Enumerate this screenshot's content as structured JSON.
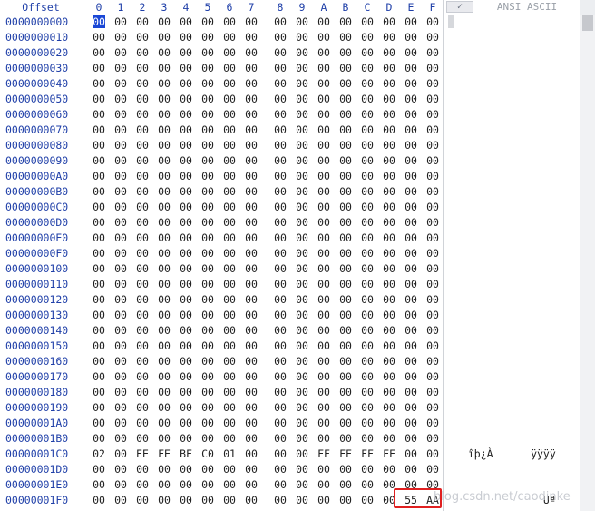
{
  "header": {
    "offset_label": "Offset",
    "columns": [
      "0",
      "1",
      "2",
      "3",
      "4",
      "5",
      "6",
      "7",
      "8",
      "9",
      "A",
      "B",
      "C",
      "D",
      "E",
      "F"
    ],
    "check_label": "✓",
    "ansi_label": "ANSI ASCII"
  },
  "rows": [
    {
      "addr": "0000000000",
      "bytes": [
        "00",
        "00",
        "00",
        "00",
        "00",
        "00",
        "00",
        "00",
        "00",
        "00",
        "00",
        "00",
        "00",
        "00",
        "00",
        "00"
      ],
      "ascii": ""
    },
    {
      "addr": "0000000010",
      "bytes": [
        "00",
        "00",
        "00",
        "00",
        "00",
        "00",
        "00",
        "00",
        "00",
        "00",
        "00",
        "00",
        "00",
        "00",
        "00",
        "00"
      ],
      "ascii": ""
    },
    {
      "addr": "0000000020",
      "bytes": [
        "00",
        "00",
        "00",
        "00",
        "00",
        "00",
        "00",
        "00",
        "00",
        "00",
        "00",
        "00",
        "00",
        "00",
        "00",
        "00"
      ],
      "ascii": ""
    },
    {
      "addr": "0000000030",
      "bytes": [
        "00",
        "00",
        "00",
        "00",
        "00",
        "00",
        "00",
        "00",
        "00",
        "00",
        "00",
        "00",
        "00",
        "00",
        "00",
        "00"
      ],
      "ascii": ""
    },
    {
      "addr": "0000000040",
      "bytes": [
        "00",
        "00",
        "00",
        "00",
        "00",
        "00",
        "00",
        "00",
        "00",
        "00",
        "00",
        "00",
        "00",
        "00",
        "00",
        "00"
      ],
      "ascii": ""
    },
    {
      "addr": "0000000050",
      "bytes": [
        "00",
        "00",
        "00",
        "00",
        "00",
        "00",
        "00",
        "00",
        "00",
        "00",
        "00",
        "00",
        "00",
        "00",
        "00",
        "00"
      ],
      "ascii": ""
    },
    {
      "addr": "0000000060",
      "bytes": [
        "00",
        "00",
        "00",
        "00",
        "00",
        "00",
        "00",
        "00",
        "00",
        "00",
        "00",
        "00",
        "00",
        "00",
        "00",
        "00"
      ],
      "ascii": ""
    },
    {
      "addr": "0000000070",
      "bytes": [
        "00",
        "00",
        "00",
        "00",
        "00",
        "00",
        "00",
        "00",
        "00",
        "00",
        "00",
        "00",
        "00",
        "00",
        "00",
        "00"
      ],
      "ascii": ""
    },
    {
      "addr": "0000000080",
      "bytes": [
        "00",
        "00",
        "00",
        "00",
        "00",
        "00",
        "00",
        "00",
        "00",
        "00",
        "00",
        "00",
        "00",
        "00",
        "00",
        "00"
      ],
      "ascii": ""
    },
    {
      "addr": "0000000090",
      "bytes": [
        "00",
        "00",
        "00",
        "00",
        "00",
        "00",
        "00",
        "00",
        "00",
        "00",
        "00",
        "00",
        "00",
        "00",
        "00",
        "00"
      ],
      "ascii": ""
    },
    {
      "addr": "00000000A0",
      "bytes": [
        "00",
        "00",
        "00",
        "00",
        "00",
        "00",
        "00",
        "00",
        "00",
        "00",
        "00",
        "00",
        "00",
        "00",
        "00",
        "00"
      ],
      "ascii": ""
    },
    {
      "addr": "00000000B0",
      "bytes": [
        "00",
        "00",
        "00",
        "00",
        "00",
        "00",
        "00",
        "00",
        "00",
        "00",
        "00",
        "00",
        "00",
        "00",
        "00",
        "00"
      ],
      "ascii": ""
    },
    {
      "addr": "00000000C0",
      "bytes": [
        "00",
        "00",
        "00",
        "00",
        "00",
        "00",
        "00",
        "00",
        "00",
        "00",
        "00",
        "00",
        "00",
        "00",
        "00",
        "00"
      ],
      "ascii": ""
    },
    {
      "addr": "00000000D0",
      "bytes": [
        "00",
        "00",
        "00",
        "00",
        "00",
        "00",
        "00",
        "00",
        "00",
        "00",
        "00",
        "00",
        "00",
        "00",
        "00",
        "00"
      ],
      "ascii": ""
    },
    {
      "addr": "00000000E0",
      "bytes": [
        "00",
        "00",
        "00",
        "00",
        "00",
        "00",
        "00",
        "00",
        "00",
        "00",
        "00",
        "00",
        "00",
        "00",
        "00",
        "00"
      ],
      "ascii": ""
    },
    {
      "addr": "00000000F0",
      "bytes": [
        "00",
        "00",
        "00",
        "00",
        "00",
        "00",
        "00",
        "00",
        "00",
        "00",
        "00",
        "00",
        "00",
        "00",
        "00",
        "00"
      ],
      "ascii": ""
    },
    {
      "addr": "0000000100",
      "bytes": [
        "00",
        "00",
        "00",
        "00",
        "00",
        "00",
        "00",
        "00",
        "00",
        "00",
        "00",
        "00",
        "00",
        "00",
        "00",
        "00"
      ],
      "ascii": ""
    },
    {
      "addr": "0000000110",
      "bytes": [
        "00",
        "00",
        "00",
        "00",
        "00",
        "00",
        "00",
        "00",
        "00",
        "00",
        "00",
        "00",
        "00",
        "00",
        "00",
        "00"
      ],
      "ascii": ""
    },
    {
      "addr": "0000000120",
      "bytes": [
        "00",
        "00",
        "00",
        "00",
        "00",
        "00",
        "00",
        "00",
        "00",
        "00",
        "00",
        "00",
        "00",
        "00",
        "00",
        "00"
      ],
      "ascii": ""
    },
    {
      "addr": "0000000130",
      "bytes": [
        "00",
        "00",
        "00",
        "00",
        "00",
        "00",
        "00",
        "00",
        "00",
        "00",
        "00",
        "00",
        "00",
        "00",
        "00",
        "00"
      ],
      "ascii": ""
    },
    {
      "addr": "0000000140",
      "bytes": [
        "00",
        "00",
        "00",
        "00",
        "00",
        "00",
        "00",
        "00",
        "00",
        "00",
        "00",
        "00",
        "00",
        "00",
        "00",
        "00"
      ],
      "ascii": ""
    },
    {
      "addr": "0000000150",
      "bytes": [
        "00",
        "00",
        "00",
        "00",
        "00",
        "00",
        "00",
        "00",
        "00",
        "00",
        "00",
        "00",
        "00",
        "00",
        "00",
        "00"
      ],
      "ascii": ""
    },
    {
      "addr": "0000000160",
      "bytes": [
        "00",
        "00",
        "00",
        "00",
        "00",
        "00",
        "00",
        "00",
        "00",
        "00",
        "00",
        "00",
        "00",
        "00",
        "00",
        "00"
      ],
      "ascii": ""
    },
    {
      "addr": "0000000170",
      "bytes": [
        "00",
        "00",
        "00",
        "00",
        "00",
        "00",
        "00",
        "00",
        "00",
        "00",
        "00",
        "00",
        "00",
        "00",
        "00",
        "00"
      ],
      "ascii": ""
    },
    {
      "addr": "0000000180",
      "bytes": [
        "00",
        "00",
        "00",
        "00",
        "00",
        "00",
        "00",
        "00",
        "00",
        "00",
        "00",
        "00",
        "00",
        "00",
        "00",
        "00"
      ],
      "ascii": ""
    },
    {
      "addr": "0000000190",
      "bytes": [
        "00",
        "00",
        "00",
        "00",
        "00",
        "00",
        "00",
        "00",
        "00",
        "00",
        "00",
        "00",
        "00",
        "00",
        "00",
        "00"
      ],
      "ascii": ""
    },
    {
      "addr": "00000001A0",
      "bytes": [
        "00",
        "00",
        "00",
        "00",
        "00",
        "00",
        "00",
        "00",
        "00",
        "00",
        "00",
        "00",
        "00",
        "00",
        "00",
        "00"
      ],
      "ascii": ""
    },
    {
      "addr": "00000001B0",
      "bytes": [
        "00",
        "00",
        "00",
        "00",
        "00",
        "00",
        "00",
        "00",
        "00",
        "00",
        "00",
        "00",
        "00",
        "00",
        "00",
        "00"
      ],
      "ascii": ""
    },
    {
      "addr": "00000001C0",
      "bytes": [
        "02",
        "00",
        "EE",
        "FE",
        "BF",
        "C0",
        "01",
        "00",
        "00",
        "00",
        "FF",
        "FF",
        "FF",
        "FF",
        "00",
        "00"
      ],
      "ascii": "  îþ¿À      ÿÿÿÿ"
    },
    {
      "addr": "00000001D0",
      "bytes": [
        "00",
        "00",
        "00",
        "00",
        "00",
        "00",
        "00",
        "00",
        "00",
        "00",
        "00",
        "00",
        "00",
        "00",
        "00",
        "00"
      ],
      "ascii": ""
    },
    {
      "addr": "00000001E0",
      "bytes": [
        "00",
        "00",
        "00",
        "00",
        "00",
        "00",
        "00",
        "00",
        "00",
        "00",
        "00",
        "00",
        "00",
        "00",
        "00",
        "00"
      ],
      "ascii": ""
    },
    {
      "addr": "00000001F0",
      "bytes": [
        "00",
        "00",
        "00",
        "00",
        "00",
        "00",
        "00",
        "00",
        "00",
        "00",
        "00",
        "00",
        "00",
        "00",
        "55",
        "AA"
      ],
      "ascii": "              Uª"
    }
  ],
  "watermark": "blog.csdn.net/caodinke",
  "colors": {
    "offset_blue": "#1f3fa8",
    "cursor": "#1a47d6",
    "highlight_border": "#e02020"
  }
}
